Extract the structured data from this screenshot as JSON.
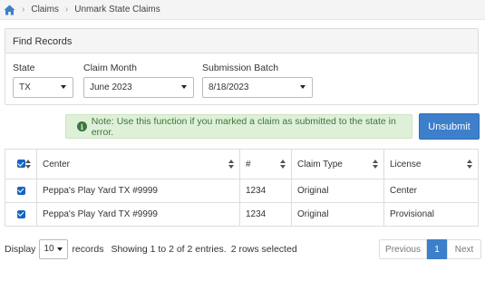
{
  "breadcrumb": {
    "home_icon": "home-icon",
    "items": [
      "Claims",
      "Unmark State Claims"
    ]
  },
  "find_records": {
    "title": "Find Records",
    "state": {
      "label": "State",
      "value": "TX"
    },
    "claim_month": {
      "label": "Claim Month",
      "value": "June 2023"
    },
    "submission_batch": {
      "label": "Submission Batch",
      "value": "8/18/2023"
    }
  },
  "note": {
    "icon": "info-circle-icon",
    "text": "Note: Use this function if you marked a claim as submitted to the state in error."
  },
  "unsubmit_label": "Unsubmit",
  "table": {
    "columns": [
      "Center",
      "#",
      "Claim Type",
      "License"
    ],
    "rows": [
      {
        "checked": true,
        "center": "Peppa's Play Yard TX #9999",
        "number": "1234",
        "claim_type": "Original",
        "license": "Center"
      },
      {
        "checked": true,
        "center": "Peppa's Play Yard TX #9999",
        "number": "1234",
        "claim_type": "Original",
        "license": "Provisional"
      }
    ]
  },
  "footer": {
    "display_label": "Display",
    "page_length": "10",
    "records_label": "records",
    "info": "Showing 1 to 2 of 2 entries.",
    "selected": "2 rows selected"
  },
  "pagination": {
    "previous": "Previous",
    "current": "1",
    "next": "Next"
  },
  "colors": {
    "primary": "#3d7fcb",
    "note_bg": "#dff0d8",
    "note_text": "#3c763d",
    "checkbox": "#1565c0"
  }
}
